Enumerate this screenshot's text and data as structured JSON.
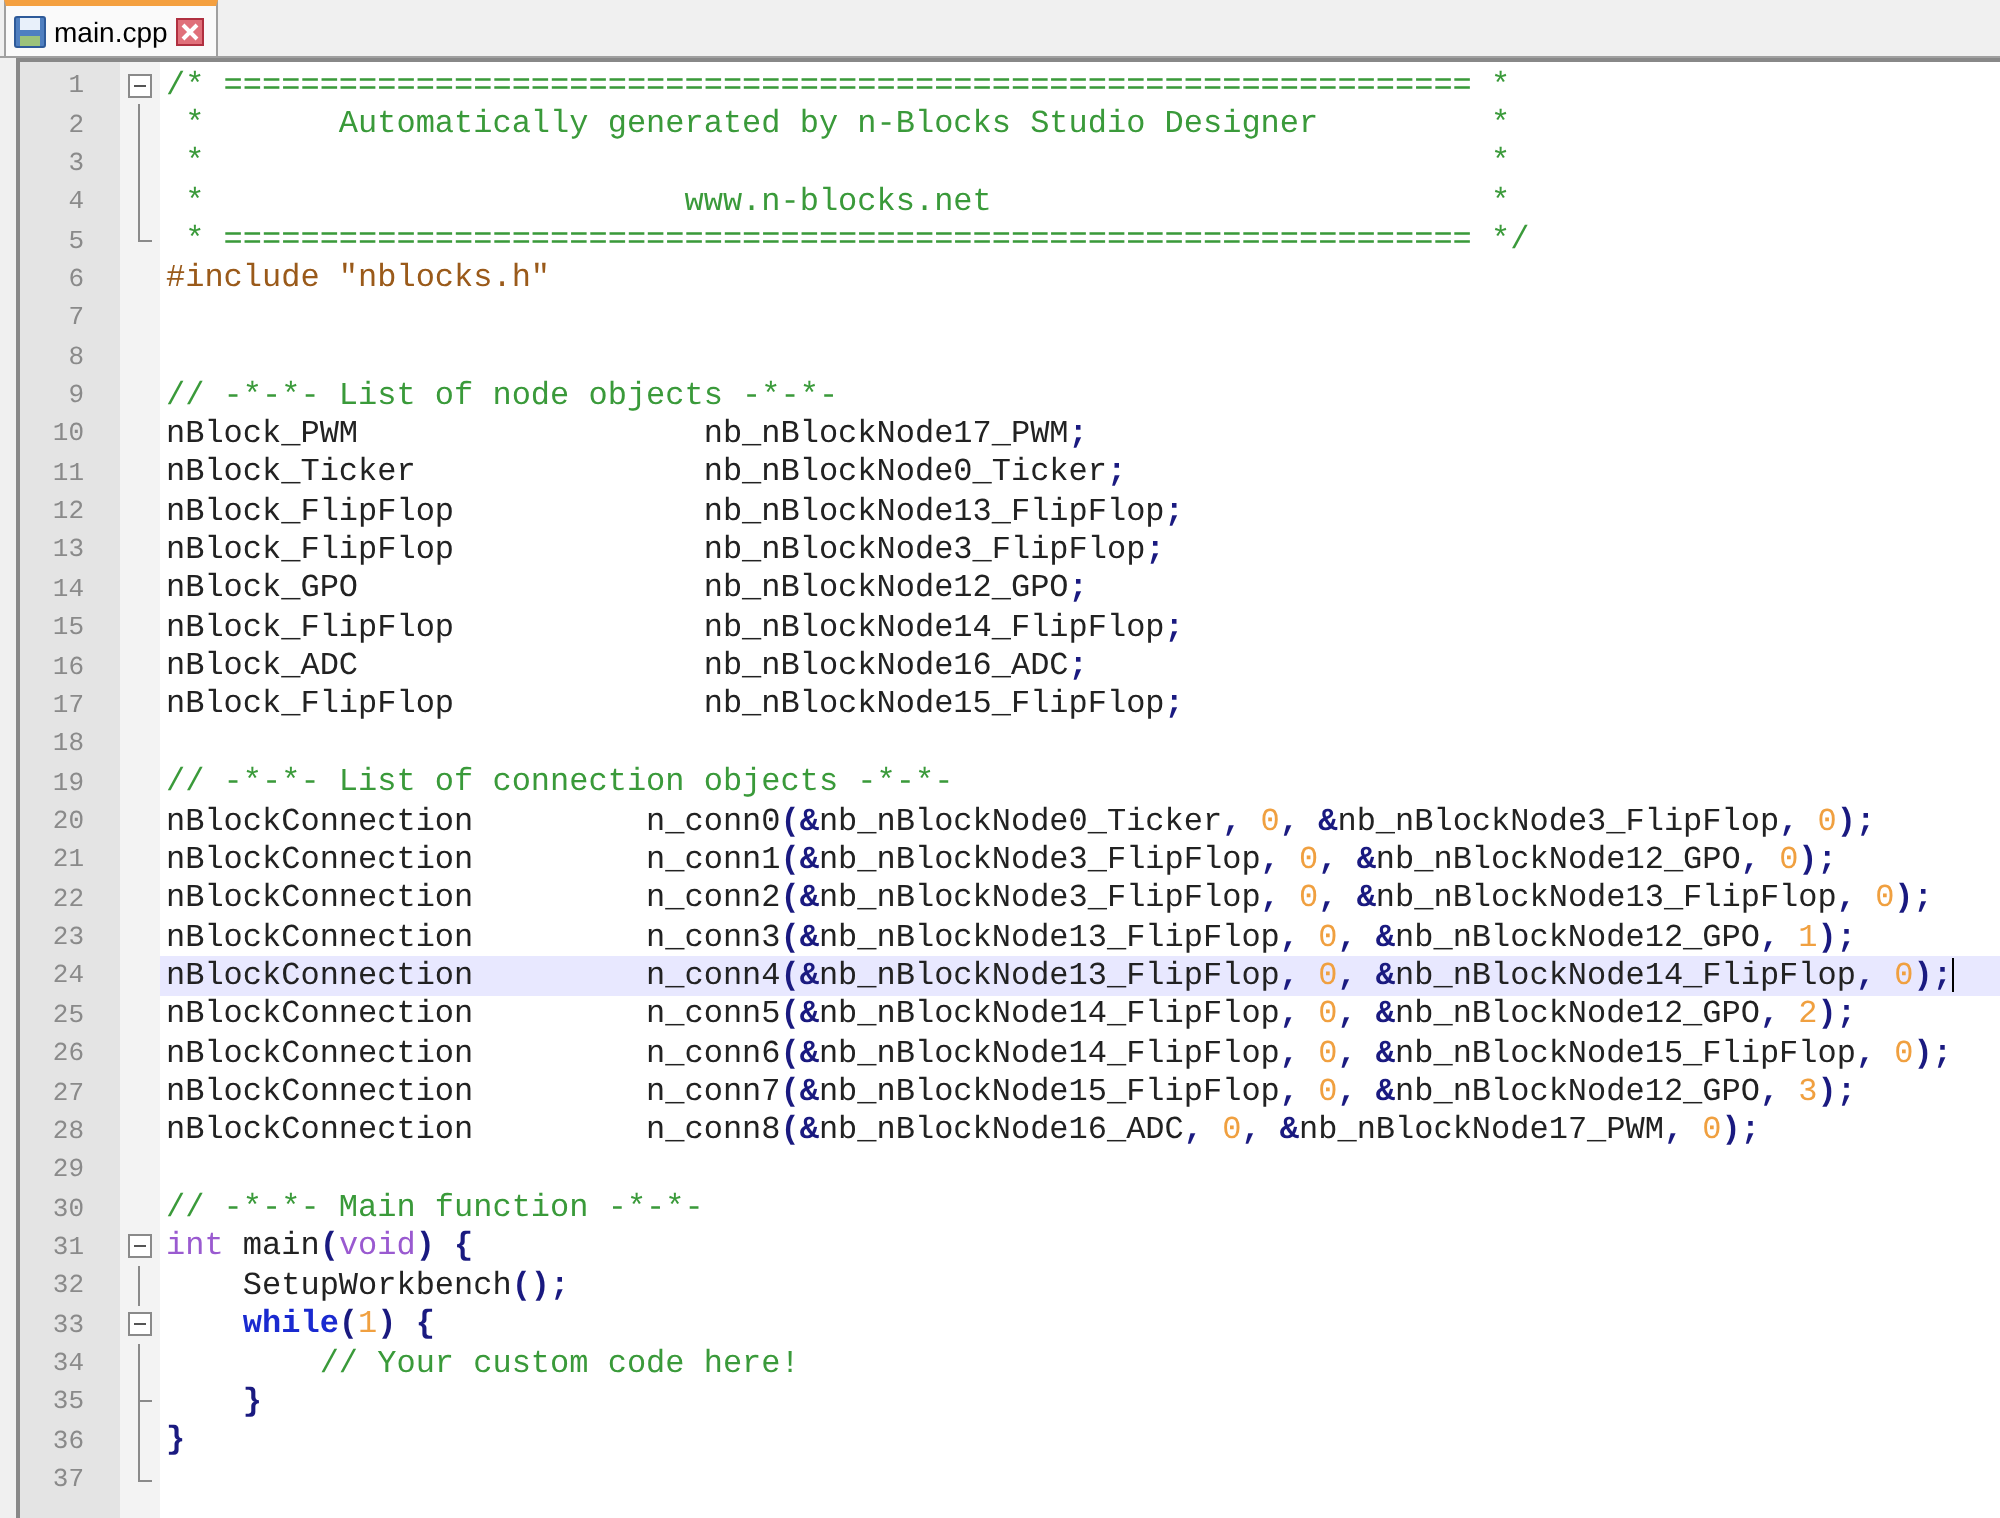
{
  "tabs": [
    {
      "label": "main.cpp",
      "selected": true
    }
  ],
  "lines": [
    {
      "number": "1",
      "fold_start": true,
      "fold_end": false,
      "current": false,
      "tokens": [
        {
          "text": "/* ================================================================= *",
          "kind": "comment"
        }
      ]
    },
    {
      "number": "2",
      "fold_start": false,
      "fold_end": false,
      "current": false,
      "tokens": [
        {
          "text": " *       Automatically generated by n-Blocks Studio Designer         *",
          "kind": "comment"
        }
      ]
    },
    {
      "number": "3",
      "fold_start": false,
      "fold_end": false,
      "current": false,
      "tokens": [
        {
          "text": " *                                                                   *",
          "kind": "comment"
        }
      ]
    },
    {
      "number": "4",
      "fold_start": false,
      "fold_end": false,
      "current": false,
      "tokens": [
        {
          "text": " *                         www.n-blocks.net                          *",
          "kind": "comment"
        }
      ]
    },
    {
      "number": "5",
      "fold_start": false,
      "fold_end": true,
      "current": false,
      "tokens": [
        {
          "text": " * ================================================================= */",
          "kind": "comment"
        }
      ]
    },
    {
      "number": "6",
      "fold_start": false,
      "fold_end": false,
      "current": false,
      "tokens": [
        {
          "text": "#include \"nblocks.h\"",
          "kind": "preproc"
        }
      ]
    },
    {
      "number": "7",
      "fold_start": false,
      "fold_end": false,
      "current": false
    },
    {
      "number": "8",
      "fold_start": false,
      "fold_end": false,
      "current": false
    },
    {
      "number": "9",
      "fold_start": false,
      "fold_end": false,
      "current": false,
      "tokens": [
        {
          "text": "// -*-*- List of node objects -*-*-",
          "kind": "comment"
        }
      ]
    },
    {
      "number": "10",
      "fold_start": false,
      "fold_end": false,
      "current": false,
      "tokens": [
        {
          "text": "nBlock_PWM                  nb_nBlockNode17_PWM",
          "kind": "plain"
        },
        {
          "text": ";",
          "kind": "op"
        }
      ]
    },
    {
      "number": "11",
      "fold_start": false,
      "fold_end": false,
      "current": false,
      "tokens": [
        {
          "text": "nBlock_Ticker               nb_nBlockNode0_Ticker",
          "kind": "plain"
        },
        {
          "text": ";",
          "kind": "op"
        }
      ]
    },
    {
      "number": "12",
      "fold_start": false,
      "fold_end": false,
      "current": false,
      "tokens": [
        {
          "text": "nBlock_FlipFlop             nb_nBlockNode13_FlipFlop",
          "kind": "plain"
        },
        {
          "text": ";",
          "kind": "op"
        }
      ]
    },
    {
      "number": "13",
      "fold_start": false,
      "fold_end": false,
      "current": false,
      "tokens": [
        {
          "text": "nBlock_FlipFlop             nb_nBlockNode3_FlipFlop",
          "kind": "plain"
        },
        {
          "text": ";",
          "kind": "op"
        }
      ]
    },
    {
      "number": "14",
      "fold_start": false,
      "fold_end": false,
      "current": false,
      "tokens": [
        {
          "text": "nBlock_GPO                  nb_nBlockNode12_GPO",
          "kind": "plain"
        },
        {
          "text": ";",
          "kind": "op"
        }
      ]
    },
    {
      "number": "15",
      "fold_start": false,
      "fold_end": false,
      "current": false,
      "tokens": [
        {
          "text": "nBlock_FlipFlop             nb_nBlockNode14_FlipFlop",
          "kind": "plain"
        },
        {
          "text": ";",
          "kind": "op"
        }
      ]
    },
    {
      "number": "16",
      "fold_start": false,
      "fold_end": false,
      "current": false,
      "tokens": [
        {
          "text": "nBlock_ADC                  nb_nBlockNode16_ADC",
          "kind": "plain"
        },
        {
          "text": ";",
          "kind": "op"
        }
      ]
    },
    {
      "number": "17",
      "fold_start": false,
      "fold_end": false,
      "current": false,
      "tokens": [
        {
          "text": "nBlock_FlipFlop             nb_nBlockNode15_FlipFlop",
          "kind": "plain"
        },
        {
          "text": ";",
          "kind": "op"
        }
      ]
    },
    {
      "number": "18",
      "fold_start": false,
      "fold_end": false,
      "current": false
    },
    {
      "number": "19",
      "fold_start": false,
      "fold_end": false,
      "current": false,
      "tokens": [
        {
          "text": "// -*-*- List of connection objects -*-*-",
          "kind": "comment"
        }
      ]
    },
    {
      "number": "20",
      "fold_start": false,
      "fold_end": false,
      "current": false,
      "tokens": [
        {
          "text": "nBlockConnection         n_conn0",
          "kind": "plain"
        },
        {
          "text": "(&",
          "kind": "op"
        },
        {
          "text": "nb_nBlockNode0_Ticker",
          "kind": "plain"
        },
        {
          "text": ", ",
          "kind": "op"
        },
        {
          "text": "0",
          "kind": "number"
        },
        {
          "text": ", &",
          "kind": "op"
        },
        {
          "text": "nb_nBlockNode3_FlipFlop",
          "kind": "plain"
        },
        {
          "text": ", ",
          "kind": "op"
        },
        {
          "text": "0",
          "kind": "number"
        },
        {
          "text": ");",
          "kind": "op"
        }
      ]
    },
    {
      "number": "21",
      "fold_start": false,
      "fold_end": false,
      "current": false,
      "tokens": [
        {
          "text": "nBlockConnection         n_conn1",
          "kind": "plain"
        },
        {
          "text": "(&",
          "kind": "op"
        },
        {
          "text": "nb_nBlockNode3_FlipFlop",
          "kind": "plain"
        },
        {
          "text": ", ",
          "kind": "op"
        },
        {
          "text": "0",
          "kind": "number"
        },
        {
          "text": ", &",
          "kind": "op"
        },
        {
          "text": "nb_nBlockNode12_GPO",
          "kind": "plain"
        },
        {
          "text": ", ",
          "kind": "op"
        },
        {
          "text": "0",
          "kind": "number"
        },
        {
          "text": ");",
          "kind": "op"
        }
      ]
    },
    {
      "number": "22",
      "fold_start": false,
      "fold_end": false,
      "current": false,
      "tokens": [
        {
          "text": "nBlockConnection         n_conn2",
          "kind": "plain"
        },
        {
          "text": "(&",
          "kind": "op"
        },
        {
          "text": "nb_nBlockNode3_FlipFlop",
          "kind": "plain"
        },
        {
          "text": ", ",
          "kind": "op"
        },
        {
          "text": "0",
          "kind": "number"
        },
        {
          "text": ", &",
          "kind": "op"
        },
        {
          "text": "nb_nBlockNode13_FlipFlop",
          "kind": "plain"
        },
        {
          "text": ", ",
          "kind": "op"
        },
        {
          "text": "0",
          "kind": "number"
        },
        {
          "text": ");",
          "kind": "op"
        }
      ]
    },
    {
      "number": "23",
      "fold_start": false,
      "fold_end": false,
      "current": false,
      "tokens": [
        {
          "text": "nBlockConnection         n_conn3",
          "kind": "plain"
        },
        {
          "text": "(&",
          "kind": "op"
        },
        {
          "text": "nb_nBlockNode13_FlipFlop",
          "kind": "plain"
        },
        {
          "text": ", ",
          "kind": "op"
        },
        {
          "text": "0",
          "kind": "number"
        },
        {
          "text": ", &",
          "kind": "op"
        },
        {
          "text": "nb_nBlockNode12_GPO",
          "kind": "plain"
        },
        {
          "text": ", ",
          "kind": "op"
        },
        {
          "text": "1",
          "kind": "number"
        },
        {
          "text": ");",
          "kind": "op"
        }
      ]
    },
    {
      "number": "24",
      "fold_start": false,
      "fold_end": false,
      "current": true,
      "tokens": [
        {
          "text": "nBlockConnection         n_conn4",
          "kind": "plain"
        },
        {
          "text": "(&",
          "kind": "op"
        },
        {
          "text": "nb_nBlockNode13_FlipFlop",
          "kind": "plain"
        },
        {
          "text": ", ",
          "kind": "op"
        },
        {
          "text": "0",
          "kind": "number"
        },
        {
          "text": ", &",
          "kind": "op"
        },
        {
          "text": "nb_nBlockNode14_FlipFlop",
          "kind": "plain"
        },
        {
          "text": ", ",
          "kind": "op"
        },
        {
          "text": "0",
          "kind": "number"
        },
        {
          "text": ");",
          "kind": "op"
        }
      ]
    },
    {
      "number": "25",
      "fold_start": false,
      "fold_end": false,
      "current": false,
      "tokens": [
        {
          "text": "nBlockConnection         n_conn5",
          "kind": "plain"
        },
        {
          "text": "(&",
          "kind": "op"
        },
        {
          "text": "nb_nBlockNode14_FlipFlop",
          "kind": "plain"
        },
        {
          "text": ", ",
          "kind": "op"
        },
        {
          "text": "0",
          "kind": "number"
        },
        {
          "text": ", &",
          "kind": "op"
        },
        {
          "text": "nb_nBlockNode12_GPO",
          "kind": "plain"
        },
        {
          "text": ", ",
          "kind": "op"
        },
        {
          "text": "2",
          "kind": "number"
        },
        {
          "text": ");",
          "kind": "op"
        }
      ]
    },
    {
      "number": "26",
      "fold_start": false,
      "fold_end": false,
      "current": false,
      "tokens": [
        {
          "text": "nBlockConnection         n_conn6",
          "kind": "plain"
        },
        {
          "text": "(&",
          "kind": "op"
        },
        {
          "text": "nb_nBlockNode14_FlipFlop",
          "kind": "plain"
        },
        {
          "text": ", ",
          "kind": "op"
        },
        {
          "text": "0",
          "kind": "number"
        },
        {
          "text": ", &",
          "kind": "op"
        },
        {
          "text": "nb_nBlockNode15_FlipFlop",
          "kind": "plain"
        },
        {
          "text": ", ",
          "kind": "op"
        },
        {
          "text": "0",
          "kind": "number"
        },
        {
          "text": ");",
          "kind": "op"
        }
      ]
    },
    {
      "number": "27",
      "fold_start": false,
      "fold_end": false,
      "current": false,
      "tokens": [
        {
          "text": "nBlockConnection         n_conn7",
          "kind": "plain"
        },
        {
          "text": "(&",
          "kind": "op"
        },
        {
          "text": "nb_nBlockNode15_FlipFlop",
          "kind": "plain"
        },
        {
          "text": ", ",
          "kind": "op"
        },
        {
          "text": "0",
          "kind": "number"
        },
        {
          "text": ", &",
          "kind": "op"
        },
        {
          "text": "nb_nBlockNode12_GPO",
          "kind": "plain"
        },
        {
          "text": ", ",
          "kind": "op"
        },
        {
          "text": "3",
          "kind": "number"
        },
        {
          "text": ");",
          "kind": "op"
        }
      ]
    },
    {
      "number": "28",
      "fold_start": false,
      "fold_end": false,
      "current": false,
      "tokens": [
        {
          "text": "nBlockConnection         n_conn8",
          "kind": "plain"
        },
        {
          "text": "(&",
          "kind": "op"
        },
        {
          "text": "nb_nBlockNode16_ADC",
          "kind": "plain"
        },
        {
          "text": ", ",
          "kind": "op"
        },
        {
          "text": "0",
          "kind": "number"
        },
        {
          "text": ", &",
          "kind": "op"
        },
        {
          "text": "nb_nBlockNode17_PWM",
          "kind": "plain"
        },
        {
          "text": ", ",
          "kind": "op"
        },
        {
          "text": "0",
          "kind": "number"
        },
        {
          "text": ");",
          "kind": "op"
        }
      ]
    },
    {
      "number": "29",
      "fold_start": false,
      "fold_end": false,
      "current": false
    },
    {
      "number": "30",
      "fold_start": false,
      "fold_end": false,
      "current": false,
      "tokens": [
        {
          "text": "// -*-*- Main function -*-*-",
          "kind": "comment"
        }
      ]
    },
    {
      "number": "31",
      "fold_start": true,
      "fold_end": false,
      "current": false,
      "tokens": [
        {
          "text": "int",
          "kind": "type"
        },
        {
          "text": " main",
          "kind": "plain"
        },
        {
          "text": "(",
          "kind": "op"
        },
        {
          "text": "void",
          "kind": "type"
        },
        {
          "text": ") {",
          "kind": "op"
        }
      ]
    },
    {
      "number": "32",
      "fold_start": false,
      "fold_end": false,
      "current": false,
      "tokens": [
        {
          "text": "    SetupWorkbench",
          "kind": "plain"
        },
        {
          "text": "();",
          "kind": "op"
        }
      ]
    },
    {
      "number": "33",
      "fold_start": true,
      "fold_end": false,
      "current": false,
      "tokens": [
        {
          "text": "    while",
          "kind": "keyword"
        },
        {
          "text": "(",
          "kind": "op"
        },
        {
          "text": "1",
          "kind": "number"
        },
        {
          "text": ") {",
          "kind": "op"
        }
      ]
    },
    {
      "number": "34",
      "fold_start": false,
      "fold_end": false,
      "current": false,
      "tokens": [
        {
          "text": "        // Your custom code here!",
          "kind": "comment"
        }
      ]
    },
    {
      "number": "35",
      "fold_start": false,
      "fold_end": true,
      "current": false,
      "tokens": [
        {
          "text": "    }",
          "kind": "op"
        }
      ]
    },
    {
      "number": "36",
      "fold_start": false,
      "fold_end": false,
      "current": false,
      "tokens": [
        {
          "text": "}",
          "kind": "op"
        }
      ]
    },
    {
      "number": "37",
      "fold_start": false,
      "fold_end": true,
      "current": false
    }
  ]
}
